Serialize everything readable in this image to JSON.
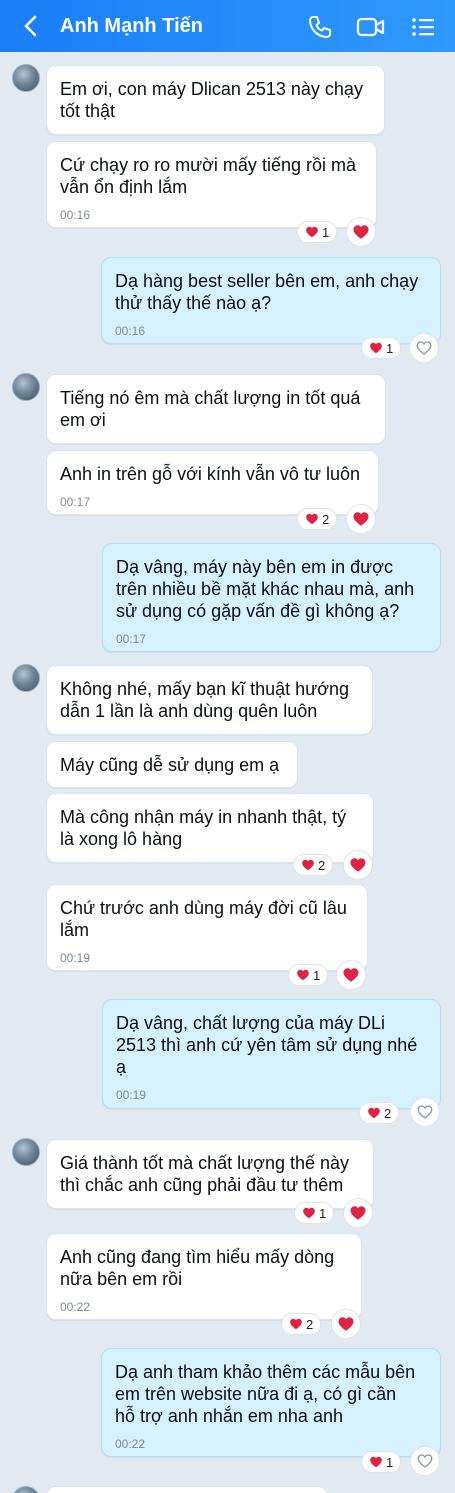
{
  "header": {
    "title": "Anh Mạnh Tiến",
    "icons": [
      "back-chevron-icon",
      "phone-icon",
      "video-call-icon",
      "menu-list-icon"
    ],
    "bg_color": "#1a7ef7"
  },
  "colors": {
    "incoming_bubble": "#ffffff",
    "outgoing_bubble": "#d5f1ff",
    "heart": "#e02245",
    "background": "#e2e9f1"
  },
  "messages": [
    {
      "text": "Em ơi, con máy Dlican 2513 này chạy\ntốt thật",
      "time": ""
    },
    {
      "text": "Cứ chạy ro ro mười mấy tiếng rồi mà\nvẫn ổn định lắm",
      "time": "00:16",
      "reaction_count": "1"
    },
    {
      "text": "Dạ hàng best seller bên em, anh chạy\nthử thấy thế nào ạ?",
      "time": "00:16",
      "reaction_count": "1"
    },
    {
      "text": "Tiếng nó êm mà chất lượng in tốt quá\nem ơi",
      "time": ""
    },
    {
      "text": "Anh in trên gỗ với kính vẫn vô tư luôn",
      "time": "00:17",
      "reaction_count": "2"
    },
    {
      "text": "Dạ vâng, máy này bên em in được\ntrên nhiều bề mặt khác nhau mà, anh\nsử dụng có gặp vấn đề gì không ạ?",
      "time": "00:17"
    },
    {
      "text": "Không nhé, mấy bạn kĩ thuật hướng\ndẫn 1 lần là anh dùng quên luôn",
      "time": ""
    },
    {
      "text": "Máy cũng dễ sử dụng em ạ",
      "time": ""
    },
    {
      "text": "Mà công nhận máy in nhanh thật, tý\nlà xong lô hàng",
      "time": "",
      "reaction_count": "2"
    },
    {
      "text": "Chứ trước anh dùng máy đời cũ lâu\nlắm",
      "time": "00:19",
      "reaction_count": "1"
    },
    {
      "text": "Dạ vâng, chất lượng của máy DLi\n2513 thì anh cứ yên tâm sử dụng nhé\nạ",
      "time": "00:19",
      "reaction_count": "2"
    },
    {
      "text": "Giá thành tốt mà chất lượng thế này\nthì chắc anh cũng phải đầu tư thêm",
      "time": "",
      "reaction_count": "1"
    },
    {
      "text": "Anh cũng đang tìm hiểu mấy dòng\nnữa bên em rồi",
      "time": "00:22",
      "reaction_count": "2"
    },
    {
      "text": "Dạ anh tham khảo thêm các mẫu bên\nem trên website nữa đi ạ, có gì cần\nhỗ trợ anh nhắn em nha anh",
      "time": "00:22",
      "reaction_count": "1"
    }
  ]
}
